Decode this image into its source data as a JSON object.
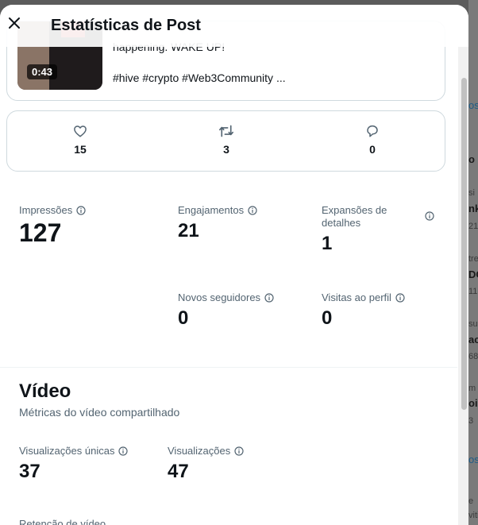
{
  "modal": {
    "title": "Estatísticas de Post"
  },
  "post": {
    "duration": "0:43",
    "text_partial": "happening. WAKE UP!",
    "hashtags": "#hive #crypto #Web3Community ..."
  },
  "engagement": {
    "likes": "15",
    "reposts": "3",
    "replies": "0"
  },
  "metrics": {
    "impressions": {
      "label": "Impressões",
      "value": "127"
    },
    "engagements": {
      "label": "Engajamentos",
      "value": "21"
    },
    "detail_expands": {
      "label": "Expansões de detalhes",
      "value": "1"
    },
    "new_followers": {
      "label": "Novos seguidores",
      "value": "0"
    },
    "profile_visits": {
      "label": "Visitas ao perfil",
      "value": "0"
    }
  },
  "video": {
    "title": "Vídeo",
    "subtitle": "Métricas do vídeo compartilhado",
    "unique_views": {
      "label": "Visualizações únicas",
      "value": "37"
    },
    "views": {
      "label": "Visualizações",
      "value": "47"
    },
    "cut_label": "Retenção de vídeo"
  },
  "background": {
    "fragments": [
      "os",
      "o",
      "si",
      "nk",
      "21",
      "tre",
      "DO",
      "11",
      "su",
      "ac",
      "68",
      "m",
      "ois",
      "3",
      "os",
      "e",
      "viti"
    ]
  },
  "colors": {
    "text_primary": "#0f1419",
    "text_secondary": "#536471",
    "border": "#cfd9de"
  },
  "icons": {
    "close": "close-icon",
    "like": "heart-icon",
    "repost": "repost-icon",
    "reply": "reply-icon",
    "info": "info-icon"
  }
}
